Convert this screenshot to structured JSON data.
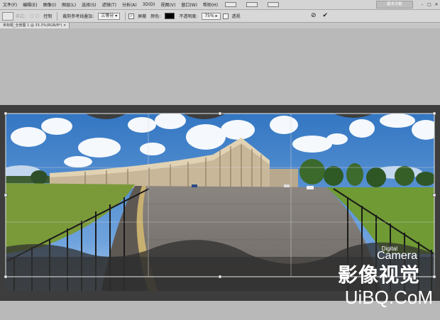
{
  "menubar": {
    "items": [
      "文件(F)",
      "编辑(E)",
      "图像(I)",
      "图层(L)",
      "选择(S)",
      "滤镜(T)",
      "分析(A)",
      "3D(D)",
      "视图(V)",
      "窗口(W)",
      "帮助(H)"
    ],
    "workspace_label": "基本功能",
    "window_controls": [
      "–",
      "□",
      "✕"
    ]
  },
  "options": {
    "faded_label": "样式:",
    "stepper_label": "控制",
    "overlay_label": "裁剪参考线叠加:",
    "overlay_value": "三等分",
    "shield_label": "屏蔽",
    "color_label": "颜色:",
    "opacity_label": "不透明度:",
    "opacity_value": "75%",
    "perspective_label": "透视",
    "cancel_glyph": "⊘",
    "commit_glyph": "✔"
  },
  "document": {
    "tab_label": "未标题_全景图 1 @ 33.3%(RGB/8*) ×"
  },
  "watermark": {
    "digital": "Digital",
    "camera": "Camera",
    "chinese": "影像视觉",
    "url": "UiBQ.CoM"
  },
  "colors": {
    "shield": "#000000",
    "menubar_bg": "#d4d4d4",
    "canvas_bg": "#b9b9b9"
  }
}
